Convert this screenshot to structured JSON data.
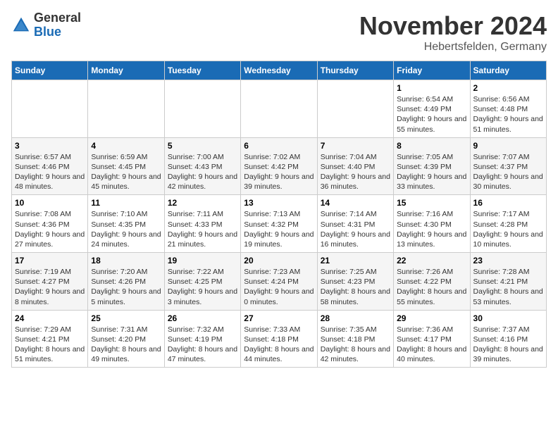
{
  "header": {
    "logo_general": "General",
    "logo_blue": "Blue",
    "month_title": "November 2024",
    "location": "Hebertsfelden, Germany"
  },
  "weekdays": [
    "Sunday",
    "Monday",
    "Tuesday",
    "Wednesday",
    "Thursday",
    "Friday",
    "Saturday"
  ],
  "weeks": [
    [
      {
        "day": "",
        "info": ""
      },
      {
        "day": "",
        "info": ""
      },
      {
        "day": "",
        "info": ""
      },
      {
        "day": "",
        "info": ""
      },
      {
        "day": "",
        "info": ""
      },
      {
        "day": "1",
        "info": "Sunrise: 6:54 AM\nSunset: 4:49 PM\nDaylight: 9 hours and 55 minutes."
      },
      {
        "day": "2",
        "info": "Sunrise: 6:56 AM\nSunset: 4:48 PM\nDaylight: 9 hours and 51 minutes."
      }
    ],
    [
      {
        "day": "3",
        "info": "Sunrise: 6:57 AM\nSunset: 4:46 PM\nDaylight: 9 hours and 48 minutes."
      },
      {
        "day": "4",
        "info": "Sunrise: 6:59 AM\nSunset: 4:45 PM\nDaylight: 9 hours and 45 minutes."
      },
      {
        "day": "5",
        "info": "Sunrise: 7:00 AM\nSunset: 4:43 PM\nDaylight: 9 hours and 42 minutes."
      },
      {
        "day": "6",
        "info": "Sunrise: 7:02 AM\nSunset: 4:42 PM\nDaylight: 9 hours and 39 minutes."
      },
      {
        "day": "7",
        "info": "Sunrise: 7:04 AM\nSunset: 4:40 PM\nDaylight: 9 hours and 36 minutes."
      },
      {
        "day": "8",
        "info": "Sunrise: 7:05 AM\nSunset: 4:39 PM\nDaylight: 9 hours and 33 minutes."
      },
      {
        "day": "9",
        "info": "Sunrise: 7:07 AM\nSunset: 4:37 PM\nDaylight: 9 hours and 30 minutes."
      }
    ],
    [
      {
        "day": "10",
        "info": "Sunrise: 7:08 AM\nSunset: 4:36 PM\nDaylight: 9 hours and 27 minutes."
      },
      {
        "day": "11",
        "info": "Sunrise: 7:10 AM\nSunset: 4:35 PM\nDaylight: 9 hours and 24 minutes."
      },
      {
        "day": "12",
        "info": "Sunrise: 7:11 AM\nSunset: 4:33 PM\nDaylight: 9 hours and 21 minutes."
      },
      {
        "day": "13",
        "info": "Sunrise: 7:13 AM\nSunset: 4:32 PM\nDaylight: 9 hours and 19 minutes."
      },
      {
        "day": "14",
        "info": "Sunrise: 7:14 AM\nSunset: 4:31 PM\nDaylight: 9 hours and 16 minutes."
      },
      {
        "day": "15",
        "info": "Sunrise: 7:16 AM\nSunset: 4:30 PM\nDaylight: 9 hours and 13 minutes."
      },
      {
        "day": "16",
        "info": "Sunrise: 7:17 AM\nSunset: 4:28 PM\nDaylight: 9 hours and 10 minutes."
      }
    ],
    [
      {
        "day": "17",
        "info": "Sunrise: 7:19 AM\nSunset: 4:27 PM\nDaylight: 9 hours and 8 minutes."
      },
      {
        "day": "18",
        "info": "Sunrise: 7:20 AM\nSunset: 4:26 PM\nDaylight: 9 hours and 5 minutes."
      },
      {
        "day": "19",
        "info": "Sunrise: 7:22 AM\nSunset: 4:25 PM\nDaylight: 9 hours and 3 minutes."
      },
      {
        "day": "20",
        "info": "Sunrise: 7:23 AM\nSunset: 4:24 PM\nDaylight: 9 hours and 0 minutes."
      },
      {
        "day": "21",
        "info": "Sunrise: 7:25 AM\nSunset: 4:23 PM\nDaylight: 8 hours and 58 minutes."
      },
      {
        "day": "22",
        "info": "Sunrise: 7:26 AM\nSunset: 4:22 PM\nDaylight: 8 hours and 55 minutes."
      },
      {
        "day": "23",
        "info": "Sunrise: 7:28 AM\nSunset: 4:21 PM\nDaylight: 8 hours and 53 minutes."
      }
    ],
    [
      {
        "day": "24",
        "info": "Sunrise: 7:29 AM\nSunset: 4:21 PM\nDaylight: 8 hours and 51 minutes."
      },
      {
        "day": "25",
        "info": "Sunrise: 7:31 AM\nSunset: 4:20 PM\nDaylight: 8 hours and 49 minutes."
      },
      {
        "day": "26",
        "info": "Sunrise: 7:32 AM\nSunset: 4:19 PM\nDaylight: 8 hours and 47 minutes."
      },
      {
        "day": "27",
        "info": "Sunrise: 7:33 AM\nSunset: 4:18 PM\nDaylight: 8 hours and 44 minutes."
      },
      {
        "day": "28",
        "info": "Sunrise: 7:35 AM\nSunset: 4:18 PM\nDaylight: 8 hours and 42 minutes."
      },
      {
        "day": "29",
        "info": "Sunrise: 7:36 AM\nSunset: 4:17 PM\nDaylight: 8 hours and 40 minutes."
      },
      {
        "day": "30",
        "info": "Sunrise: 7:37 AM\nSunset: 4:16 PM\nDaylight: 8 hours and 39 minutes."
      }
    ]
  ]
}
